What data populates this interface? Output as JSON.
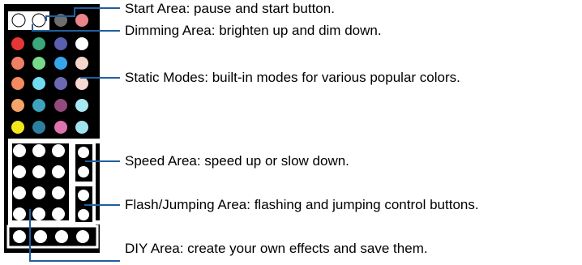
{
  "colors": {
    "leader_line": "#1f5fa0",
    "remote_body": "#000000",
    "panel_white": "#ffffff"
  },
  "start_area": {
    "buttons": [
      {
        "name": "pause",
        "color": "#ffffff"
      },
      {
        "name": "start",
        "color": "#ffffff"
      },
      {
        "name": "dim-gray",
        "color": "#6e6e6e"
      },
      {
        "name": "pink",
        "color": "#e8868c"
      }
    ]
  },
  "static_modes": {
    "rows": [
      [
        "#e83636",
        "#3aa87a",
        "#5a5fb0",
        "#ffffff"
      ],
      [
        "#ef7f67",
        "#79d98a",
        "#36a6ec",
        "#f7d5cb"
      ],
      [
        "#f5895f",
        "#6fdcf0",
        "#6c68b2",
        "#f6d9d2"
      ],
      [
        "#f6a469",
        "#3fa3bd",
        "#934a7c",
        "#a8e8f2"
      ],
      [
        "#f4e61c",
        "#2d7f9f",
        "#df73b0",
        "#a0e2f0"
      ]
    ]
  },
  "labels": {
    "start": "Start Area: pause and start button.",
    "dimming": "Dimming Area: brighten up and dim down.",
    "static": "Static Modes: built-in modes for various popular colors.",
    "speed": "Speed Area: speed up or slow down.",
    "flash": "Flash/Jumping Area: flashing and jumping control buttons.",
    "diy": "DIY Area: create your own effects and save them."
  }
}
